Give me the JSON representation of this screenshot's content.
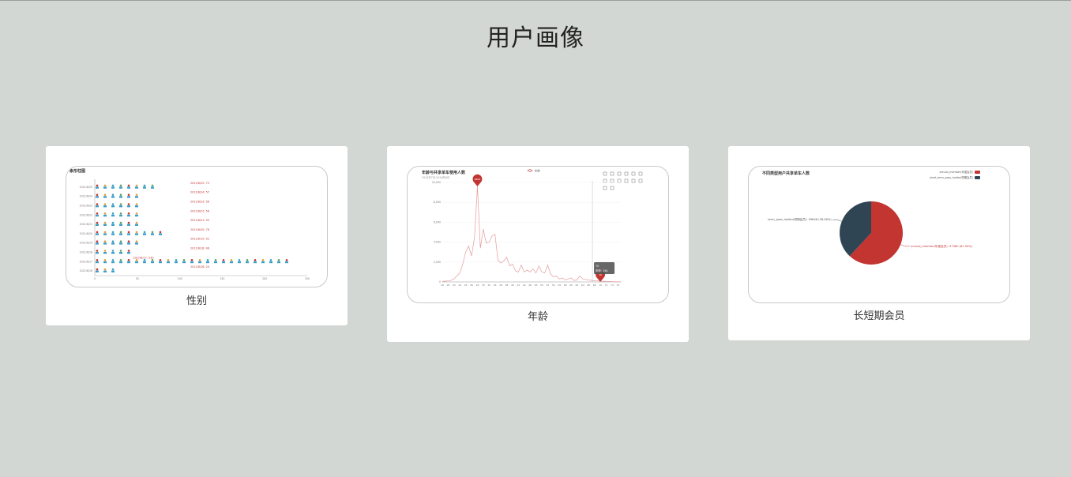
{
  "page": {
    "title": "用户画像"
  },
  "cards": [
    {
      "caption": "性别"
    },
    {
      "caption": "年龄"
    },
    {
      "caption": "长短期会员"
    }
  ],
  "colors": {
    "accent_red": "#c23531",
    "dark_slate": "#2f4554",
    "pink_line": "#e69a9a"
  },
  "chart_data": [
    {
      "type": "bar",
      "title": "象形柱图",
      "categories": [
        "2021/6/25",
        "2021/6/24",
        "2021/6/23",
        "2021/6/22",
        "2021/6/21",
        "2021/6/20",
        "2021/6/19",
        "2021/6/18",
        "2021/6/17",
        "2021/6/16"
      ],
      "values": [
        75,
        57,
        56,
        58,
        55,
        78,
        52,
        46,
        230,
        24
      ],
      "value_labels": [
        "2021/6/25: 75",
        "2021/6/24: 57",
        "2021/6/23: 56",
        "2021/6/22: 58",
        "2021/6/21: 55",
        "2021/6/20: 78",
        "2021/6/19: 52",
        "2021/6/18: 46",
        "2021/6/17: 230",
        "2021/6/16: 24"
      ],
      "x_ticks": [
        "0",
        "50",
        "100",
        "150",
        "200",
        "250"
      ],
      "xlim": [
        0,
        250
      ]
    },
    {
      "type": "line",
      "title": "年龄与共享单车使用人数",
      "subtitle": "2016年7月-2016年8月",
      "legend": [
        "年龄"
      ],
      "y_ticks": [
        "0",
        "2,000",
        "4,000",
        "6,000",
        "8,000",
        "10,000"
      ],
      "ylim": [
        0,
        10000
      ],
      "x": [
        16,
        17,
        18,
        19,
        20,
        21,
        22,
        23,
        24,
        25,
        26,
        27,
        28,
        29,
        30,
        31,
        32,
        33,
        34,
        35,
        36,
        37,
        38,
        39,
        40,
        41,
        42,
        43,
        44,
        45,
        46,
        47,
        48,
        49,
        50,
        51,
        52,
        53,
        54,
        55,
        56,
        57,
        58,
        59,
        60,
        61,
        62,
        63,
        64,
        65,
        66,
        67,
        68,
        69,
        70,
        71,
        72,
        73,
        74,
        75,
        76,
        77
      ],
      "values": [
        50,
        80,
        100,
        150,
        300,
        600,
        900,
        1800,
        3000,
        3600,
        2600,
        4500,
        9600,
        3400,
        5300,
        3900,
        4000,
        4600,
        4800,
        2200,
        1900,
        2100,
        2500,
        1600,
        1800,
        1100,
        1000,
        1700,
        1000,
        1200,
        1000,
        1300,
        900,
        1600,
        1000,
        900,
        1700,
        800,
        500,
        600,
        300,
        400,
        200,
        300,
        400,
        150,
        200,
        600,
        300,
        250,
        200,
        150,
        120,
        100,
        80,
        60,
        50,
        40,
        30,
        20,
        10,
        20
      ],
      "markers": [
        {
          "x": 28,
          "value": 9600,
          "label": "9600"
        },
        {
          "x": 70,
          "value": 10,
          "label": "10"
        }
      ],
      "x_ticks": [
        "16",
        "18",
        "20",
        "22",
        "24",
        "26",
        "28",
        "30",
        "32",
        "34",
        "36",
        "38",
        "40",
        "42",
        "44",
        "46",
        "48",
        "50",
        "52",
        "54",
        "56",
        "58",
        "60",
        "62",
        "64",
        "66",
        "68",
        "70",
        "72",
        "74",
        "76"
      ],
      "tooltip": {
        "title": "70",
        "text": "年龄: 244"
      }
    },
    {
      "type": "pie",
      "title": "不同类型用户共享单车人数",
      "legend": [
        "annual_member(年度会员)",
        "short_term_pass_holder(短期会员)"
      ],
      "slices": [
        {
          "name": "annual_member(年度会员)",
          "value": 97360,
          "label": "annual_member(年度会员): 97360 (61.93%)",
          "color": "#c23531"
        },
        {
          "name": "term_pass_holder(短期会员)",
          "value": 59846,
          "label": "term_pass_holder(短期会员): 59846 (38.06%)",
          "color": "#2f4554"
        }
      ]
    }
  ]
}
